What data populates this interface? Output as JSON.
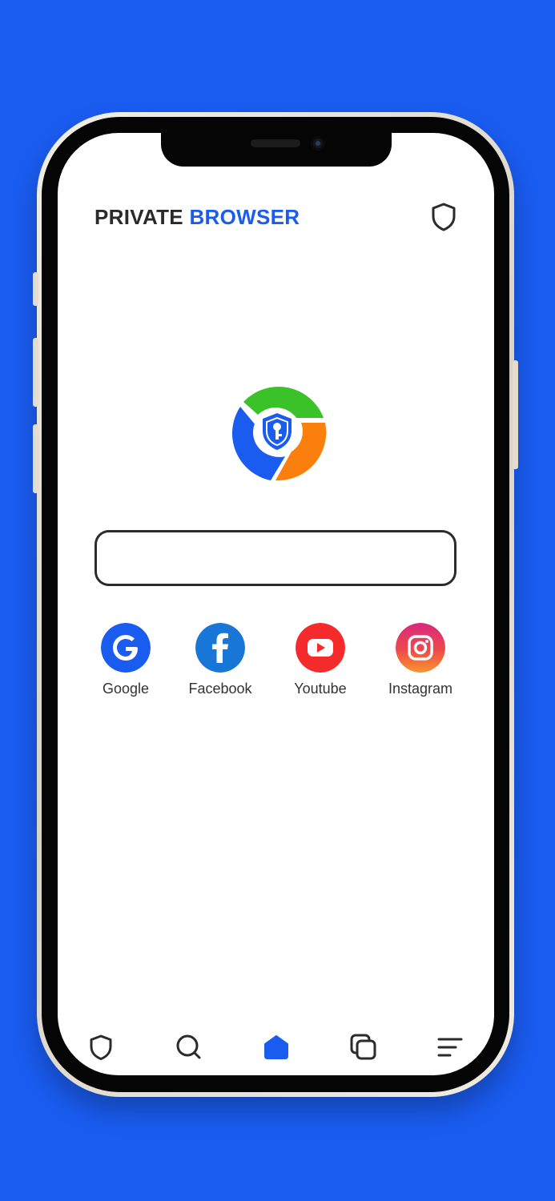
{
  "app": {
    "title_part1": "PRIVATE",
    "title_part2": "BROWSER"
  },
  "colors": {
    "background": "#1a5cf0",
    "accent": "#1a5cf0",
    "logo_green": "#3cc229",
    "logo_orange": "#fb7f0c",
    "logo_blue": "#1a5cf0"
  },
  "header": {
    "shield_icon": "shield-outline-icon"
  },
  "search": {
    "value": "",
    "placeholder": ""
  },
  "shortcuts": [
    {
      "label": "Google",
      "icon": "google-icon",
      "color": "#1a5cf0"
    },
    {
      "label": "Facebook",
      "icon": "facebook-icon",
      "color": "#1877d6"
    },
    {
      "label": "Youtube",
      "icon": "youtube-icon",
      "color": "#f52a2a"
    },
    {
      "label": "Instagram",
      "icon": "instagram-icon",
      "color": "#e23a6d"
    }
  ],
  "bottom_nav": [
    {
      "icon": "shield-icon",
      "active": false
    },
    {
      "icon": "search-icon",
      "active": false
    },
    {
      "icon": "home-icon",
      "active": true
    },
    {
      "icon": "tabs-icon",
      "active": false
    },
    {
      "icon": "menu-icon",
      "active": false
    }
  ]
}
